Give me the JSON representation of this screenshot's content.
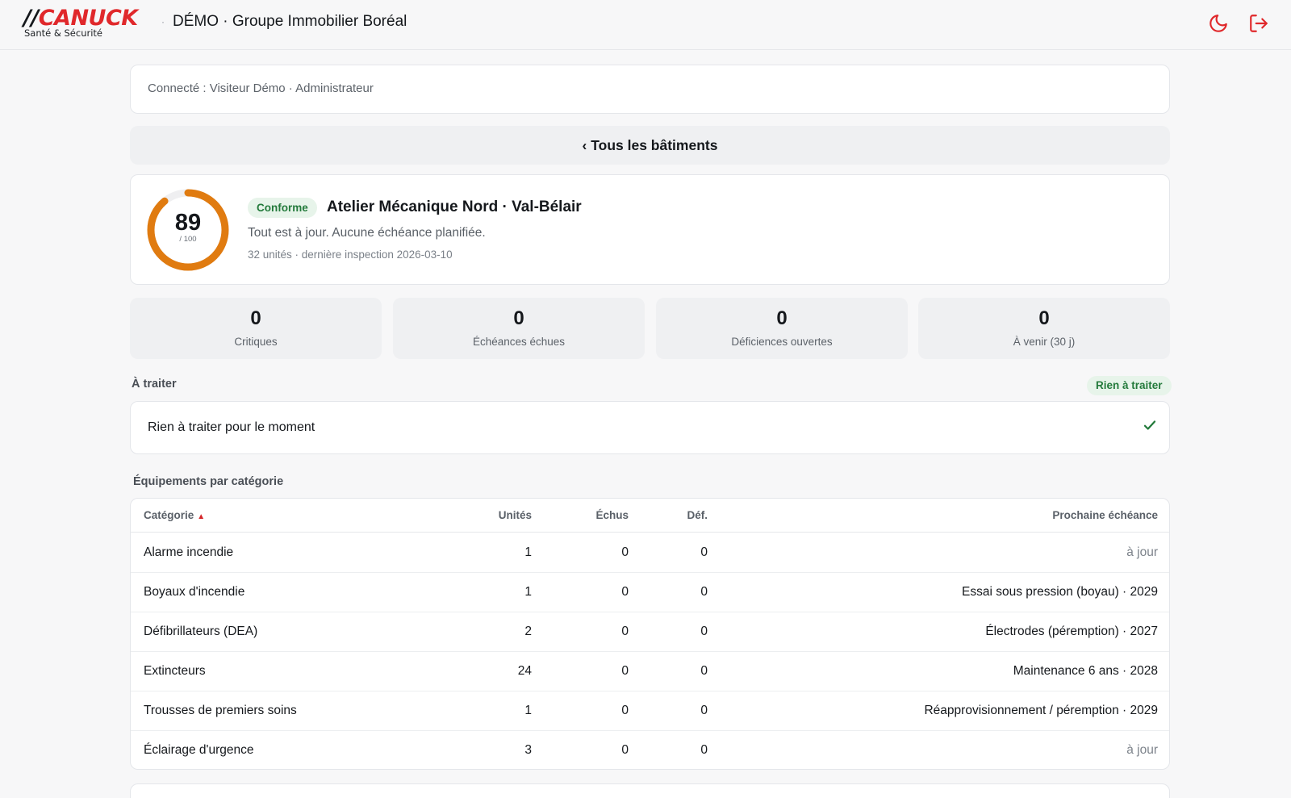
{
  "header": {
    "logo_slashes": "//",
    "logo_word": "CANUCK",
    "logo_sub": "Santé & Sécurité",
    "separator": "·",
    "title": "DÉMO · Groupe Immobilier Boréal",
    "accent_color": "#e0282b",
    "icons": [
      "moon-icon",
      "logout-icon"
    ]
  },
  "session": {
    "connected_text": "Connecté : Visiteur Démo · Administrateur"
  },
  "nav": {
    "back_label": "‹ Tous les bâtiments"
  },
  "building": {
    "score": "89",
    "score_max": "/ 100",
    "score_fraction": 0.89,
    "gauge_color": "#e07b10",
    "status_badge": "Conforme",
    "name": "Atelier Mécanique Nord · Val-Bélair",
    "status_text": "Tout est à jour. Aucune échéance planifiée.",
    "meta": "32 unités · dernière inspection 2026-03-10"
  },
  "stats": [
    {
      "value": "0",
      "label": "Critiques"
    },
    {
      "value": "0",
      "label": "Échéances échues"
    },
    {
      "value": "0",
      "label": "Déficiences ouvertes"
    },
    {
      "value": "0",
      "label": "À venir (30 j)"
    }
  ],
  "todo": {
    "title": "À traiter",
    "badge": "Rien à traiter",
    "empty_text": "Rien à traiter pour le moment",
    "check_glyph": "✓"
  },
  "equipment": {
    "title": "Équipements par catégorie",
    "columns": {
      "category": "Catégorie",
      "sort_indicator": "▲",
      "units": "Unités",
      "overdue": "Échus",
      "deficiencies": "Déf.",
      "next_due": "Prochaine échéance"
    },
    "rows": [
      {
        "category": "Alarme incendie",
        "units": "1",
        "overdue": "0",
        "deficiencies": "0",
        "next_due": "à jour"
      },
      {
        "category": "Boyaux d'incendie",
        "units": "1",
        "overdue": "0",
        "deficiencies": "0",
        "next_due": "Essai sous pression (boyau) · 2029"
      },
      {
        "category": "Défibrillateurs (DEA)",
        "units": "2",
        "overdue": "0",
        "deficiencies": "0",
        "next_due": "Électrodes (péremption) · 2027"
      },
      {
        "category": "Extincteurs",
        "units": "24",
        "overdue": "0",
        "deficiencies": "0",
        "next_due": "Maintenance 6 ans · 2028"
      },
      {
        "category": "Trousses de premiers soins",
        "units": "1",
        "overdue": "0",
        "deficiencies": "0",
        "next_due": "Réapprovisionnement / péremption · 2029"
      },
      {
        "category": "Éclairage d'urgence",
        "units": "3",
        "overdue": "0",
        "deficiencies": "0",
        "next_due": "à jour"
      }
    ]
  }
}
